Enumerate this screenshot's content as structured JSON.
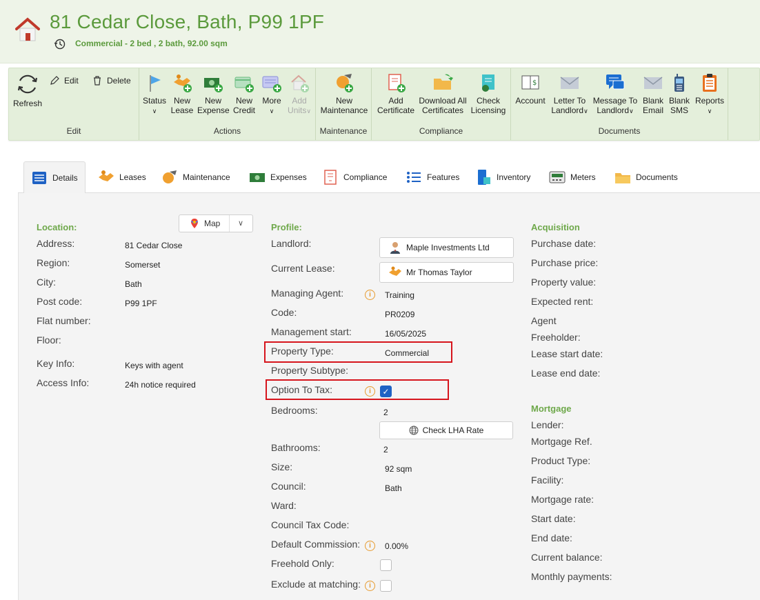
{
  "header": {
    "title": "81 Cedar Close, Bath, P99 1PF",
    "subtitle": "Commercial - 2 bed , 2 bath, 92.00 sqm"
  },
  "ribbon": {
    "edit_group": {
      "label": "Edit",
      "refresh": "Refresh",
      "edit": "Edit",
      "delete": "Delete"
    },
    "actions_group": {
      "label": "Actions",
      "status": "Status",
      "new_lease": [
        "New",
        "Lease"
      ],
      "new_expense": [
        "New",
        "Expense"
      ],
      "new_credit": [
        "New",
        "Credit"
      ],
      "more": "More",
      "add_units": [
        "Add",
        "Units"
      ]
    },
    "maintenance_group": {
      "label": "Maintenance",
      "new_maintenance": [
        "New",
        "Maintenance"
      ]
    },
    "compliance_group": {
      "label": "Compliance",
      "add_certificate": [
        "Add",
        "Certificate"
      ],
      "download_all": [
        "Download All",
        "Certificates"
      ],
      "check_licensing": [
        "Check",
        "Licensing"
      ]
    },
    "documents_group": {
      "label": "Documents",
      "account": "Account",
      "letter_to_landlord": [
        "Letter To",
        "Landlord"
      ],
      "message_to_landlord": [
        "Message To",
        "Landlord"
      ],
      "blank_email": [
        "Blank",
        "Email"
      ],
      "blank_sms": [
        "Blank",
        "SMS"
      ],
      "reports": "Reports"
    }
  },
  "tabs": [
    "Details",
    "Leases",
    "Maintenance",
    "Expenses",
    "Compliance",
    "Features",
    "Inventory",
    "Meters",
    "Documents"
  ],
  "location": {
    "title": "Location:",
    "map_label": "Map",
    "rows": [
      {
        "label": "Address:",
        "value": "81 Cedar Close"
      },
      {
        "label": "Region:",
        "value": "Somerset"
      },
      {
        "label": "City:",
        "value": "Bath"
      },
      {
        "label": "Post code:",
        "value": "P99 1PF"
      },
      {
        "label": "Flat number:",
        "value": ""
      },
      {
        "label": "Floor:",
        "value": ""
      },
      {
        "label": "Key Info:",
        "value": "Keys with agent"
      },
      {
        "label": "Access Info:",
        "value": "24h notice required"
      }
    ]
  },
  "profile": {
    "title": "Profile:",
    "landlord_label": "Landlord:",
    "landlord_value": "Maple Investments Ltd",
    "current_lease_label": "Current Lease:",
    "current_lease_value": "Mr Thomas Taylor",
    "managing_agent_label": "Managing Agent:",
    "managing_agent_value": "Training",
    "code_label": "Code:",
    "code_value": "PR0209",
    "management_start_label": "Management start:",
    "management_start_value": "16/05/2025",
    "property_type_label": "Property Type:",
    "property_type_value": "Commercial",
    "property_subtype_label": "Property Subtype:",
    "option_to_tax_label": "Option To Tax:",
    "option_to_tax_checked": true,
    "bedrooms_label": "Bedrooms:",
    "bedrooms_value": "2",
    "check_lha_label": "Check LHA Rate",
    "bathrooms_label": "Bathrooms:",
    "bathrooms_value": "2",
    "size_label": "Size:",
    "size_value": "92 sqm",
    "council_label": "Council:",
    "council_value": "Bath",
    "ward_label": "Ward:",
    "council_tax_code_label": "Council Tax Code:",
    "default_commission_label": "Default Commission:",
    "default_commission_value": "0.00%",
    "freehold_only_label": "Freehold Only:",
    "exclude_matching_label": "Exclude at matching:"
  },
  "acquisition": {
    "title": "Acquisition",
    "rows": [
      "Purchase date:",
      "Purchase price:",
      "Property value:",
      "Expected rent:",
      "Agent",
      "Freeholder:",
      "Lease start date:",
      "Lease end date:"
    ]
  },
  "mortgage": {
    "title": "Mortgage",
    "rows": [
      "Lender:",
      "Mortgage Ref.",
      "Product Type:",
      "Facility:",
      "Mortgage rate:",
      "Start date:",
      "End date:",
      "Current balance:",
      "Monthly payments:"
    ]
  },
  "colors": {
    "accent_green": "#5b9a3c",
    "highlight_red": "#d6141c",
    "checkbox_blue": "#1f62c4"
  }
}
